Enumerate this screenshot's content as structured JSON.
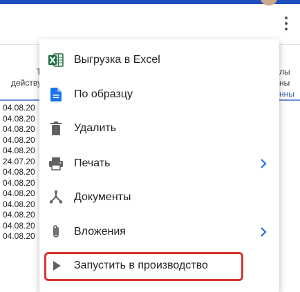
{
  "table": {
    "header_left": "Т\nдейству",
    "header_right": "лы\nны",
    "header_right_link": "нны",
    "rows": [
      "04.08.20",
      "04.08.20",
      "04.08.20",
      "04.08.20",
      "04.08.20",
      "24.07.20",
      "04.08.20",
      "04.08.20",
      "04.08.20",
      "04.08.20",
      "04.08.20",
      "04.08.20",
      "04.08.20"
    ]
  },
  "menu": {
    "items": [
      {
        "label": "Выгрузка в Excel",
        "icon": "excel-icon"
      },
      {
        "label": "По образцу",
        "icon": "document-icon"
      },
      {
        "label": "Удалить",
        "icon": "trash-icon"
      },
      {
        "label": "Печать",
        "icon": "printer-icon",
        "submenu": true
      },
      {
        "label": "Документы",
        "icon": "documents-hub-icon"
      },
      {
        "label": "Вложения",
        "icon": "paperclip-icon",
        "submenu": true
      },
      {
        "label": "Запустить в производство",
        "icon": "play-icon"
      }
    ]
  },
  "colors": {
    "accent": "#1f4fbf",
    "excel_green": "#1d6f42",
    "icon_blue": "#1a73e8",
    "icon_gray": "#616161",
    "highlight_red": "#d7352f"
  }
}
